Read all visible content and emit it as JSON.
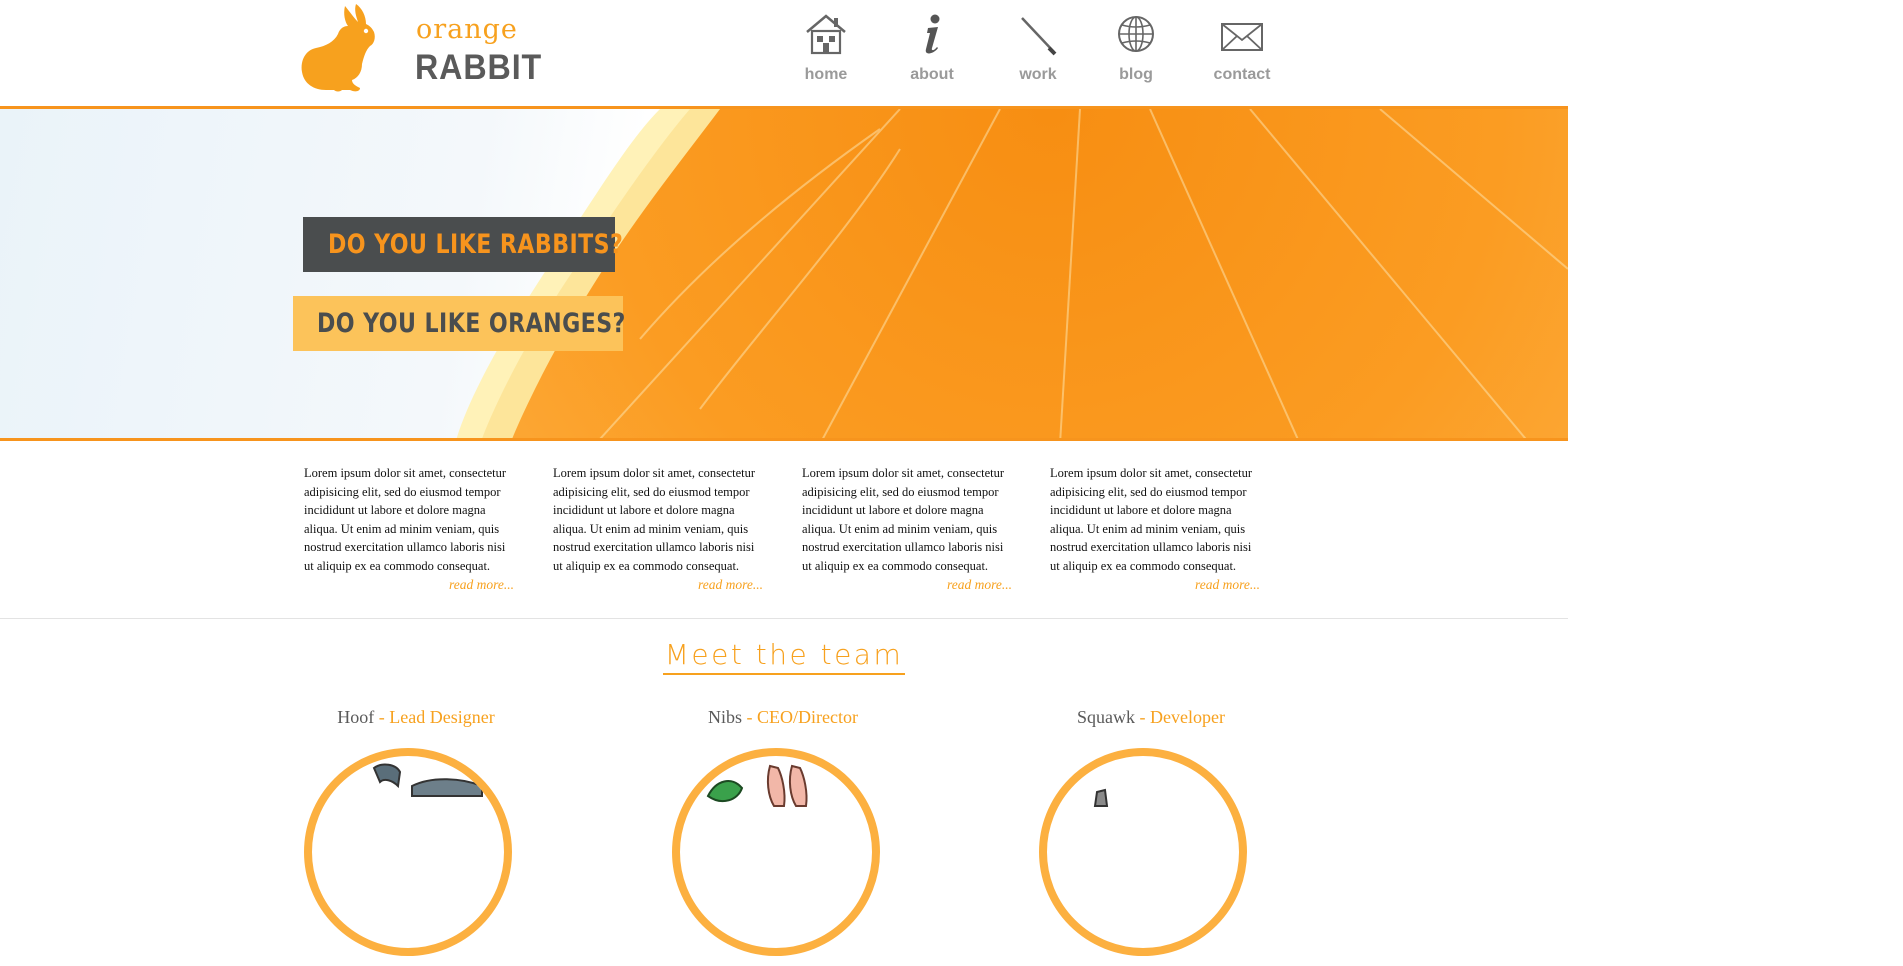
{
  "logo": {
    "word1": "orange",
    "word2": "RABBIT"
  },
  "nav": [
    {
      "label": "home",
      "icon": "home-icon"
    },
    {
      "label": "about",
      "icon": "info-icon"
    },
    {
      "label": "work",
      "icon": "pencil-icon"
    },
    {
      "label": "blog",
      "icon": "globe-icon"
    },
    {
      "label": "contact",
      "icon": "envelope-icon"
    }
  ],
  "banner": {
    "headline1": "DO YOU LIKE RABBITS?",
    "headline2": "DO YOU LIKE ORANGES?"
  },
  "columns": [
    {
      "text": "Lorem ipsum dolor sit amet, consectetur adipisicing elit, sed do eiusmod tempor incididunt ut labore et dolore magna aliqua. Ut enim ad minim veniam, quis nostrud exercitation ullamco laboris nisi ut aliquip ex ea commodo consequat.",
      "link": "read more..."
    },
    {
      "text": "Lorem ipsum dolor sit amet, consectetur adipisicing elit, sed do eiusmod tempor incididunt ut labore et dolore magna aliqua. Ut enim ad minim veniam, quis nostrud exercitation ullamco laboris nisi ut aliquip ex ea commodo consequat.",
      "link": "read more..."
    },
    {
      "text": "Lorem ipsum dolor sit amet, consectetur adipisicing elit, sed do eiusmod tempor incididunt ut labore et dolore magna aliqua. Ut enim ad minim veniam, quis nostrud exercitation ullamco laboris nisi ut aliquip ex ea commodo consequat.",
      "link": "read more..."
    },
    {
      "text": "Lorem ipsum dolor sit amet, consectetur adipisicing elit, sed do eiusmod tempor incididunt ut labore et dolore magna aliqua. Ut enim ad minim veniam, quis nostrud exercitation ullamco laboris nisi ut aliquip ex ea commodo consequat.",
      "link": "read more..."
    }
  ],
  "team": {
    "title": "Meet the team",
    "members": [
      {
        "name": "Hoof",
        "separator": " - ",
        "role": "Lead Designer"
      },
      {
        "name": "Nibs",
        "separator": " - ",
        "role": "CEO/Director"
      },
      {
        "name": "Squawk",
        "separator": " - ",
        "role": "Developer"
      }
    ]
  },
  "colors": {
    "accent": "#f7941d",
    "dark": "#4a4d4e",
    "light_accent": "#fcc35a",
    "nav_text": "#9a9a9a"
  }
}
